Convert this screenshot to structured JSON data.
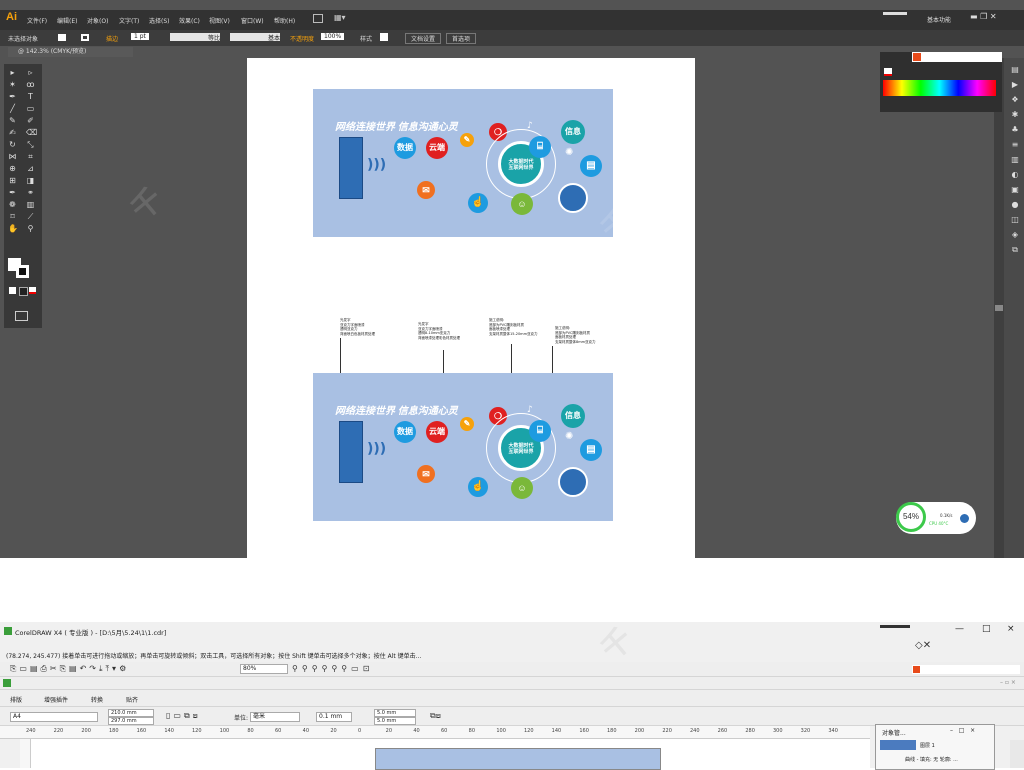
{
  "illustrator": {
    "logo": "Ai",
    "menus": [
      "文件(F)",
      "编辑(E)",
      "对象(O)",
      "文字(T)",
      "选择(S)",
      "效果(C)",
      "视图(V)",
      "窗口(W)",
      "帮助(H)"
    ],
    "workspace": "基本功能",
    "control": {
      "no_selection": "未选择对象",
      "stroke_label": "描边",
      "stroke_value": "1 pt",
      "profile": "等比",
      "brush": "基本",
      "opacity_label": "不透明度",
      "opacity_value": "100%",
      "style_label": "样式",
      "doc_setup": "文档设置",
      "preferences": "首选项"
    },
    "doc_tab": "@ 142.3% (CMYK/预览)",
    "design": {
      "title": "网络连接世界 信息沟通心灵",
      "label_data": "数据",
      "label_cloud": "云端",
      "label_info": "信息",
      "center_text": "大数据时代\n互联网世界"
    },
    "notes": [
      "光发字\n亚克力字面喷漆\n透明亚克力\n背面喷白色板材质处理",
      "光发字\n亚克力字面喷漆\n透明8-10mm亚克力\n背面喷漆处理彩色材质处理",
      "施工说明:\n底部为PVC雕刻板材质\n面板喷漆处理\n支架材质整体15-20mm亚克力",
      "施工说明:\n底部为PVC雕刻板材质\n面板材质处理\n支架材质整体8mm亚克力"
    ],
    "cpu": {
      "percent": "54%",
      "speed": "0.1K/s",
      "temp": "CPU 40°C"
    },
    "colors": {
      "accent": "#f6a10b",
      "design_bg": "#a9c0e3",
      "dark_blue": "#2e6db4"
    }
  },
  "coreldraw": {
    "title": "CorelDRAW X4 ( 专业版 ) - [D:\\5月\\5.24\\1\\1.cdr]",
    "status": "(78.274, 245.477)    接着单击可进行拖动或缩放；再单击可旋转或倾斜；双击工具，可选择所有对象；按住 Shift 键单击可选择多个对象；按住 Alt 键单击...",
    "zoom": "80%",
    "page_size": "A4",
    "width": "210.0 mm",
    "height": "297.0 mm",
    "units_label": "单位:",
    "units": "毫米",
    "nudge": "0.1 mm",
    "dup_x": "5.0 mm",
    "dup_y": "5.0 mm",
    "tabs": [
      "排版",
      "增强插件",
      "转换",
      "贴齐"
    ],
    "ruler": [
      "240",
      "220",
      "200",
      "180",
      "160",
      "140",
      "120",
      "100",
      "80",
      "60",
      "40",
      "20",
      "0",
      "20",
      "40",
      "60",
      "80",
      "100",
      "120",
      "140",
      "160",
      "180",
      "200",
      "220",
      "240",
      "260",
      "280",
      "300",
      "320",
      "340"
    ],
    "object_manager": "对象管...",
    "object_row": "曲线 - 填充: 无  轮廓: ...",
    "layer_label": "图层 1",
    "window_controls": [
      "—",
      "□",
      "×"
    ]
  }
}
